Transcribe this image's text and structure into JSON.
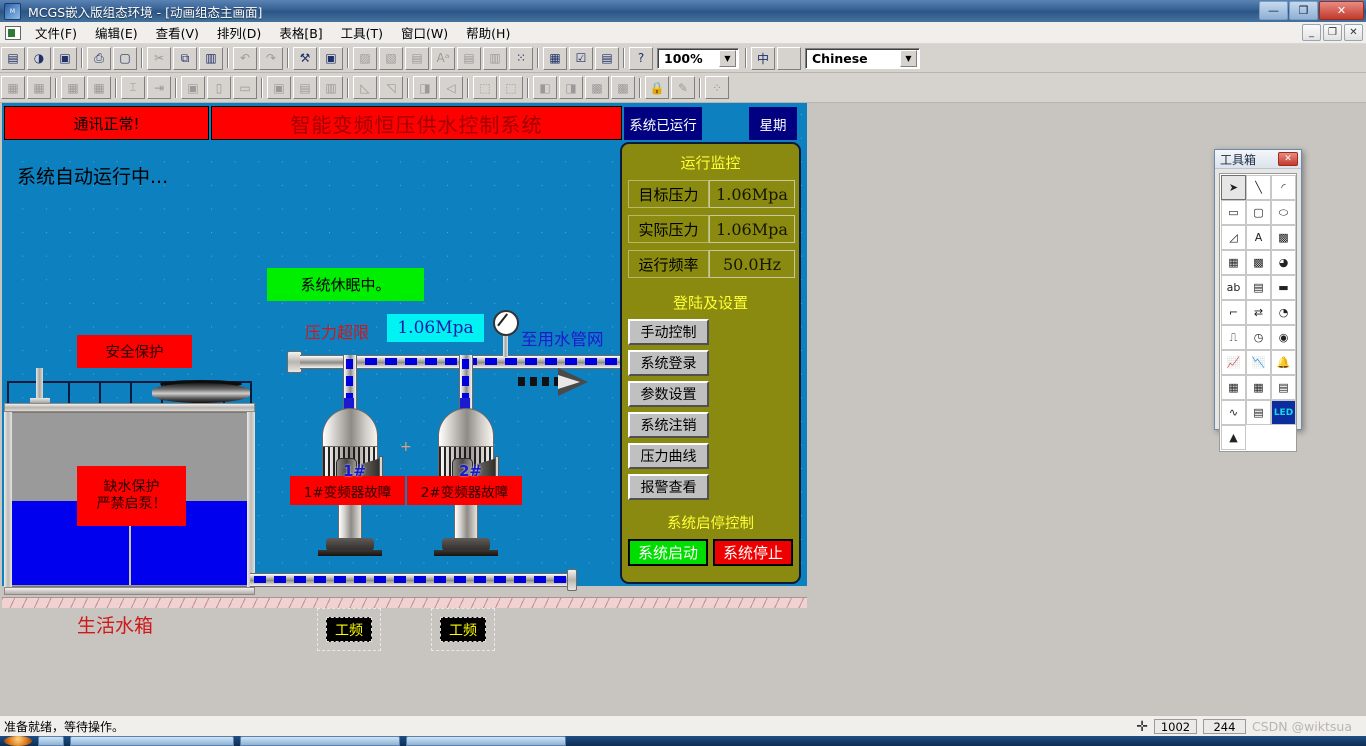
{
  "window": {
    "title": "MCGS嵌入版组态环境 - [动画组态主画面]",
    "icon": "mcgs-app-icon",
    "minimize": "—",
    "maximize": "❐",
    "close": "✕",
    "mdi_minimize": "_",
    "mdi_restore": "❐",
    "mdi_close": "✕"
  },
  "menu": {
    "items": [
      {
        "label": "文件(F)"
      },
      {
        "label": "编辑(E)"
      },
      {
        "label": "查看(V)"
      },
      {
        "label": "排列(D)"
      },
      {
        "label": "表格[B]"
      },
      {
        "label": "工具(T)"
      },
      {
        "label": "窗口(W)"
      },
      {
        "label": "帮助(H)"
      }
    ]
  },
  "toolbar": {
    "zoom": {
      "value": "100%",
      "arrow": "▼"
    },
    "language": {
      "value": "Chinese",
      "arrow": "▼"
    },
    "row1": [
      {
        "name": "new-window-icon",
        "glyph": "▤"
      },
      {
        "name": "open-project-icon",
        "glyph": "◑"
      },
      {
        "name": "save-icon",
        "glyph": "▣"
      },
      {
        "name": "print-icon",
        "glyph": "⎙"
      },
      {
        "name": "print-preview-icon",
        "glyph": "▢"
      },
      {
        "name": "cut-icon",
        "glyph": "✂"
      },
      {
        "name": "copy-icon",
        "glyph": "⧉"
      },
      {
        "name": "paste-icon",
        "glyph": "▥"
      },
      {
        "name": "undo-icon",
        "glyph": "↶"
      },
      {
        "name": "redo-icon",
        "glyph": "↷"
      },
      {
        "name": "tools-icon",
        "glyph": "⚒"
      },
      {
        "name": "frame-icon",
        "glyph": "▣"
      },
      {
        "name": "fill-color-icon",
        "glyph": "▨"
      },
      {
        "name": "line-color-icon",
        "glyph": "▧"
      },
      {
        "name": "text-color-icon",
        "glyph": "▤"
      },
      {
        "name": "font-icon",
        "glyph": "Aᵃ"
      },
      {
        "name": "align-block-icon",
        "glyph": "▤"
      },
      {
        "name": "align-left-icon",
        "glyph": "▥"
      },
      {
        "name": "grid-icon",
        "glyph": "⁙"
      },
      {
        "name": "script-icon",
        "glyph": "▦"
      },
      {
        "name": "check-icon",
        "glyph": "☑"
      },
      {
        "name": "sort-icon",
        "glyph": "▤"
      },
      {
        "name": "help-pointer-icon",
        "glyph": "?"
      },
      {
        "name": "ime-icon",
        "glyph": "中"
      }
    ],
    "row2": [
      {
        "name": "align-left-edge-icon",
        "glyph": "▦"
      },
      {
        "name": "align-right-edge-icon",
        "glyph": "▦"
      },
      {
        "name": "align-top-edge-icon",
        "glyph": "▦"
      },
      {
        "name": "align-bottom-edge-icon",
        "glyph": "▦"
      },
      {
        "name": "center-vertical-icon",
        "glyph": "⌶"
      },
      {
        "name": "center-horizontal-icon",
        "glyph": "⇥"
      },
      {
        "name": "same-size-icon",
        "glyph": "▣"
      },
      {
        "name": "same-height-icon",
        "glyph": "▯"
      },
      {
        "name": "same-width-icon",
        "glyph": "▭"
      },
      {
        "name": "center-page-icon",
        "glyph": "▣"
      },
      {
        "name": "space-horizontal-icon",
        "glyph": "▤"
      },
      {
        "name": "space-vertical-icon",
        "glyph": "▥"
      },
      {
        "name": "rotate-left-icon",
        "glyph": "◺"
      },
      {
        "name": "rotate-right-icon",
        "glyph": "◹"
      },
      {
        "name": "flip-horizontal-icon",
        "glyph": "◨"
      },
      {
        "name": "flip-vertical-icon",
        "glyph": "◁"
      },
      {
        "name": "group-icon",
        "glyph": "⬚"
      },
      {
        "name": "ungroup-icon",
        "glyph": "⬚"
      },
      {
        "name": "bring-front-icon",
        "glyph": "◧"
      },
      {
        "name": "send-back-icon",
        "glyph": "◨"
      },
      {
        "name": "bring-forward-icon",
        "glyph": "▩"
      },
      {
        "name": "send-backward-icon",
        "glyph": "▩"
      },
      {
        "name": "lock-icon",
        "glyph": "🔒"
      },
      {
        "name": "unlock-icon",
        "glyph": "✎"
      },
      {
        "name": "grid-snap-icon",
        "glyph": "⁘"
      }
    ]
  },
  "hmi": {
    "header": {
      "comm_status": "通讯正常!",
      "title": "智能变频恒压供水控制系统",
      "run_status": "系统已运行",
      "weekday": "星期"
    },
    "auto_run_text": "系统自动运行中...",
    "sleep_text": "系统休眠中。",
    "safety_protect": "安全保护",
    "low_water_line1": "缺水保护",
    "low_water_line2": "严禁启泵！",
    "tank_label": "生活水箱",
    "pressure_over_limit": "压力超限",
    "pressure_display": "1.06Mpa",
    "to_water_network": "至用水管网",
    "pump1_num": "1#",
    "pump2_num": "2#",
    "pump1_fault": "1#变频器故障",
    "pump2_fault": "2#变频器故障",
    "freq1": "工频",
    "freq2": "工频",
    "cross_mark": "+"
  },
  "panel": {
    "monitor_title": "运行监控",
    "rows": [
      {
        "label": "目标压力",
        "value": "1.06Mpa"
      },
      {
        "label": "实际压力",
        "value": "1.06Mpa"
      },
      {
        "label": "运行频率",
        "value": "50.0Hz"
      }
    ],
    "login_title": "登陆及设置",
    "buttons": [
      {
        "label": "手动控制"
      },
      {
        "label": "系统登录"
      },
      {
        "label": "参数设置"
      },
      {
        "label": "系统注销"
      },
      {
        "label": "压力曲线"
      },
      {
        "label": "报警查看"
      }
    ],
    "startstop_title": "系统启停控制",
    "start_label": "系统启动",
    "stop_label": "系统停止"
  },
  "toolbox": {
    "title": "工具箱",
    "close": "✕",
    "tools": [
      {
        "name": "select-arrow-tool",
        "glyph": "➤",
        "selected": true
      },
      {
        "name": "line-tool",
        "glyph": "╲"
      },
      {
        "name": "arc-tool",
        "glyph": "◜"
      },
      {
        "name": "rectangle-tool",
        "glyph": "▭"
      },
      {
        "name": "rounded-rect-tool",
        "glyph": "▢"
      },
      {
        "name": "ellipse-tool",
        "glyph": "⬭"
      },
      {
        "name": "polygon-tool",
        "glyph": "◿"
      },
      {
        "name": "text-tool",
        "glyph": "A"
      },
      {
        "name": "image-tool",
        "glyph": "▩"
      },
      {
        "name": "insert-element-tool",
        "glyph": "▦"
      },
      {
        "name": "element-library-tool",
        "glyph": "▩"
      },
      {
        "name": "fill-tool",
        "glyph": "◕"
      },
      {
        "name": "label-tool",
        "glyph": "ab"
      },
      {
        "name": "slider-tool",
        "glyph": "▤"
      },
      {
        "name": "level-meter-tool",
        "glyph": "▬"
      },
      {
        "name": "bar-graph-tool",
        "glyph": "⌐"
      },
      {
        "name": "flow-block-tool",
        "glyph": "⇄"
      },
      {
        "name": "dial-tool",
        "glyph": "◔"
      },
      {
        "name": "switch-tool",
        "glyph": "⎍"
      },
      {
        "name": "meter-tool",
        "glyph": "◷"
      },
      {
        "name": "indicator-lamp-tool",
        "glyph": "◉"
      },
      {
        "name": "realtime-curve-tool",
        "glyph": "📈"
      },
      {
        "name": "history-curve-tool",
        "glyph": "📉"
      },
      {
        "name": "alarm-bell-tool",
        "glyph": "🔔"
      },
      {
        "name": "table-tool",
        "glyph": "▦"
      },
      {
        "name": "report-table-tool",
        "glyph": "▦"
      },
      {
        "name": "database-tool",
        "glyph": "▤"
      },
      {
        "name": "xy-curve-tool",
        "glyph": "∿"
      },
      {
        "name": "form-tool",
        "glyph": "▤"
      },
      {
        "name": "led-tool",
        "glyph": "LED"
      },
      {
        "name": "animation-tool",
        "glyph": "▲"
      }
    ]
  },
  "statusbar": {
    "message": "准备就绪，等待操作。",
    "cursor_icon": "crosshair-icon",
    "coord_x": "1002",
    "coord_y": "244",
    "watermark": "CSDN @wiktsua"
  }
}
